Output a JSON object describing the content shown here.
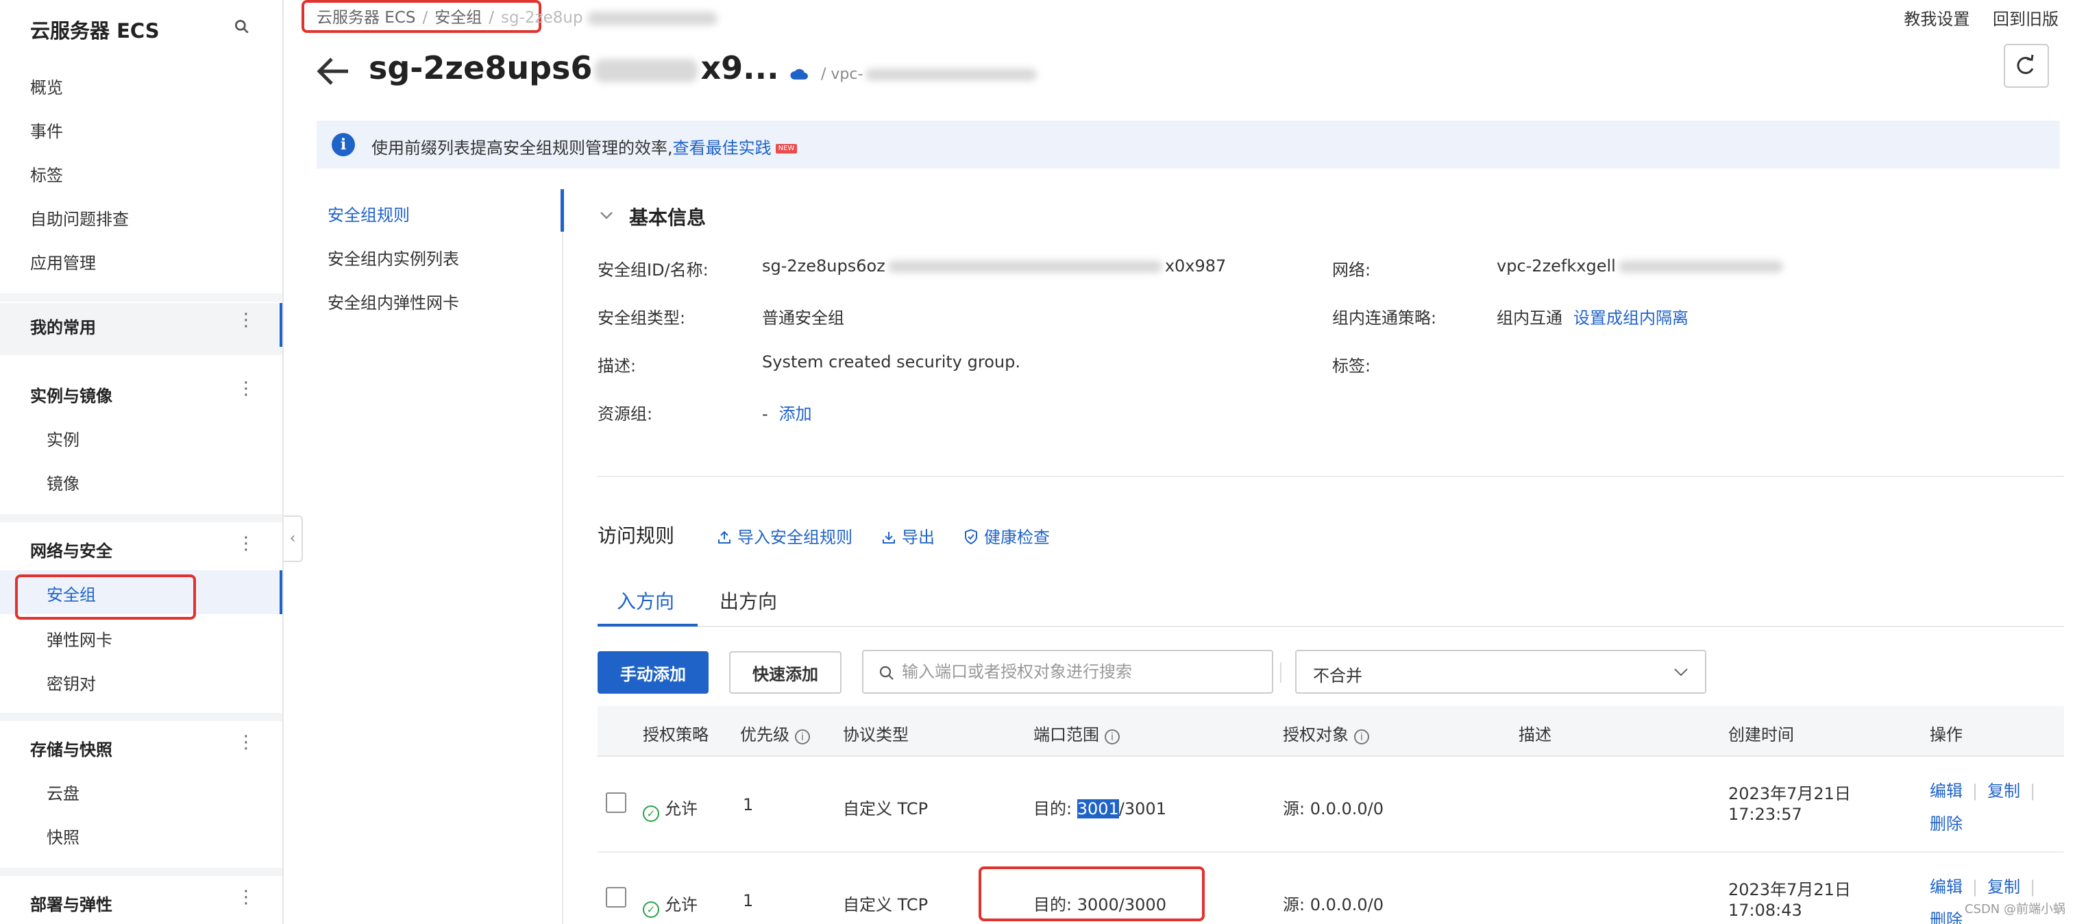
{
  "sidebar": {
    "header": "云服务器 ECS",
    "top_items": [
      "概览",
      "事件",
      "标签",
      "自助问题排查",
      "应用管理"
    ],
    "favorites_label": "我的常用",
    "groups": [
      {
        "label": "实例与镜像",
        "items": [
          "实例",
          "镜像"
        ]
      },
      {
        "label": "网络与安全",
        "items": [
          "安全组",
          "弹性网卡",
          "密钥对"
        ]
      },
      {
        "label": "存储与快照",
        "items": [
          "云盘",
          "快照"
        ]
      },
      {
        "label": "部署与弹性",
        "items": []
      }
    ]
  },
  "breadcrumb": {
    "items": [
      "云服务器 ECS",
      "安全组"
    ],
    "current": "sg-2ze8up"
  },
  "top_links": {
    "tutorial": "教我设置",
    "old_version": "回到旧版"
  },
  "title": {
    "prefix": "sg-2ze8ups6",
    "suffix": "x9...",
    "vpc": "/ vpc-"
  },
  "notice": {
    "text": "使用前缀列表提高安全组规则管理的效率,",
    "link": "查看最佳实践",
    "tag": "NEW"
  },
  "subnav": [
    "安全组规则",
    "安全组内实例列表",
    "安全组内弹性网卡"
  ],
  "basic_info": {
    "title": "基本信息",
    "fields": {
      "id_label": "安全组ID/名称:",
      "id_prefix": "sg-2ze8ups6oz",
      "id_suffix": "x0x987",
      "network_label": "网络:",
      "network_value": "vpc-2zefkxgell",
      "type_label": "安全组类型:",
      "type_value": "普通安全组",
      "policy_label": "组内连通策略:",
      "policy_value": "组内互通",
      "policy_link": "设置成组内隔离",
      "desc_label": "描述:",
      "desc_value": "System created security group.",
      "tags_label": "标签:",
      "rg_label": "资源组:",
      "rg_value": "-",
      "rg_link": "添加"
    }
  },
  "rules": {
    "title": "访问规则",
    "actions": {
      "import": "导入安全组规则",
      "export": "导出",
      "health": "健康检查"
    },
    "tabs": {
      "inbound": "入方向",
      "outbound": "出方向"
    },
    "toolbar": {
      "manual_add": "手动添加",
      "quick_add": "快速添加",
      "search_placeholder": "输入端口或者授权对象进行搜索",
      "merge_value": "不合并"
    },
    "columns": [
      "授权策略",
      "优先级",
      "协议类型",
      "端口范围",
      "授权对象",
      "描述",
      "创建时间",
      "操作"
    ],
    "rows": [
      {
        "policy": "允许",
        "priority": "1",
        "protocol": "自定义 TCP",
        "port_prefix": "目的: ",
        "port_highlight": "3001",
        "port_rest": "/3001",
        "source": "源: 0.0.0.0/0",
        "description": "",
        "date": "2023年7月21日",
        "time": "17:23:57",
        "ops": {
          "edit": "编辑",
          "copy": "复制",
          "delete": "删除"
        }
      },
      {
        "policy": "允许",
        "priority": "1",
        "protocol": "自定义 TCP",
        "port_prefix": "目的: ",
        "port_highlight": "",
        "port_rest": "3000/3000",
        "source": "源: 0.0.0.0/0",
        "description": "",
        "date": "2023年7月21日",
        "time": "17:08:43",
        "ops": {
          "edit": "编辑",
          "copy": "复制",
          "delete": "删除"
        }
      }
    ]
  },
  "watermark": "CSDN @前端小蜗",
  "colors": {
    "accent": "#1f63c9",
    "annotation": "#e0322e",
    "allow": "#2aa24a"
  }
}
